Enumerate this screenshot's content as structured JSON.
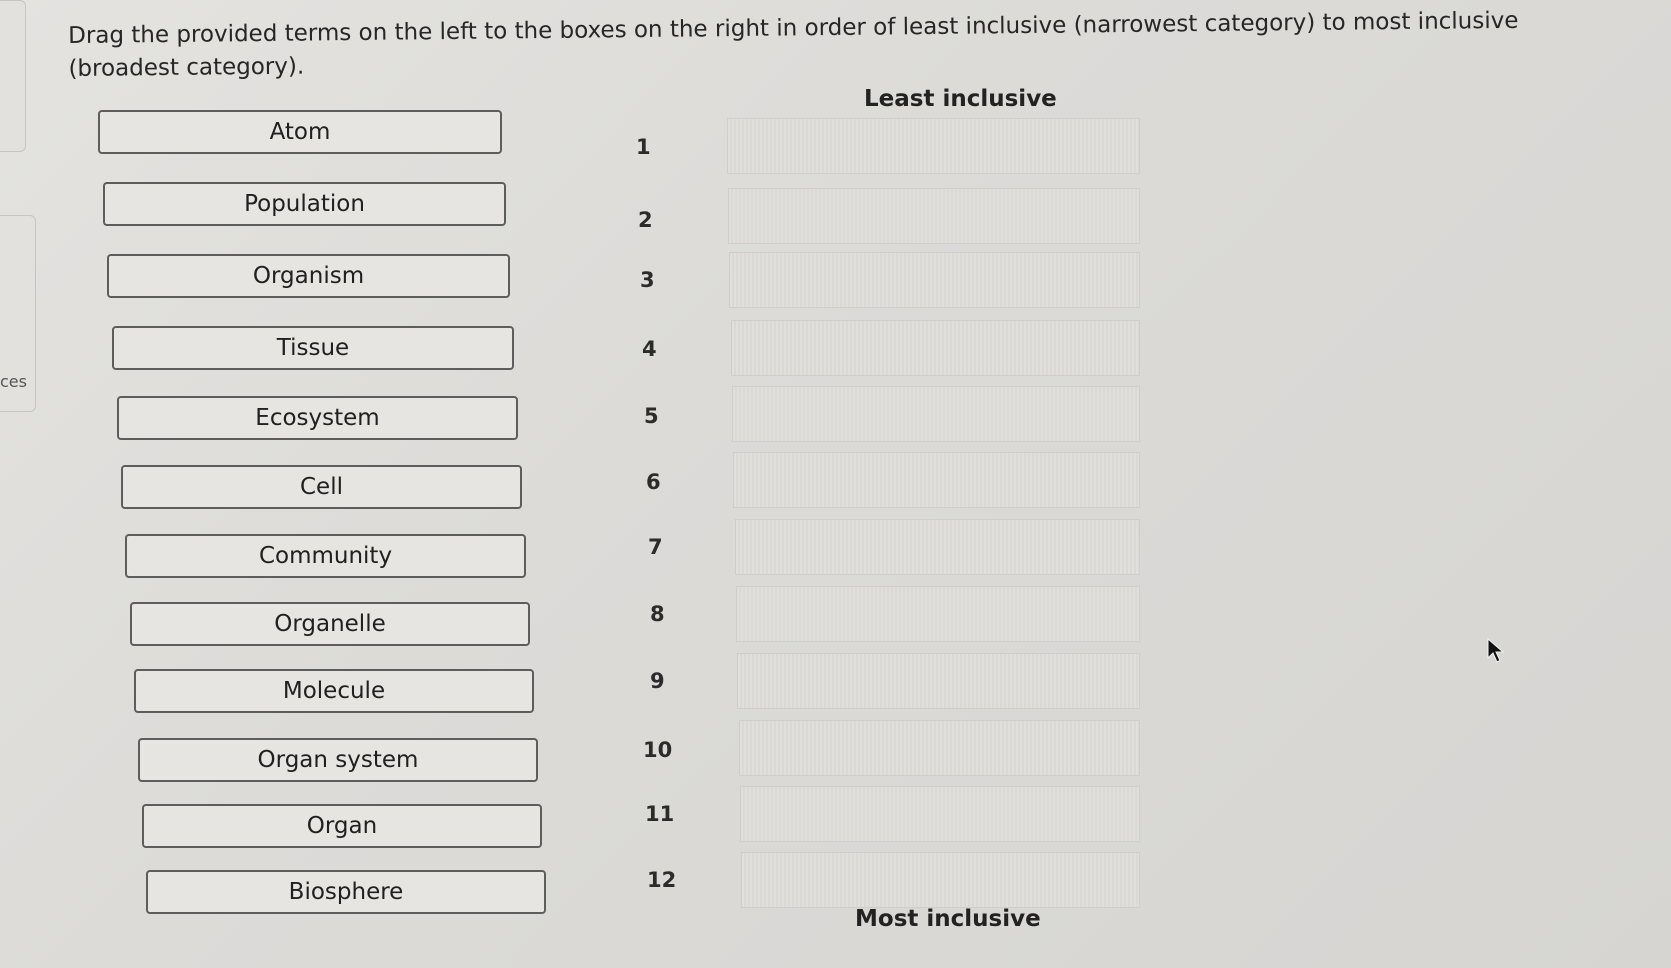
{
  "instructions": "Drag the provided terms on the left to the boxes on the right in order of least inclusive (narrowest category) to most inclusive (broadest category).",
  "side_panel_text": "ces",
  "header_top": "Least inclusive",
  "header_bottom": "Most inclusive",
  "terms": [
    "Atom",
    "Population",
    "Organism",
    "Tissue",
    "Ecosystem",
    "Cell",
    "Community",
    "Organelle",
    "Molecule",
    "Organ system",
    "Organ",
    "Biosphere"
  ],
  "slot_numbers": [
    "1",
    "2",
    "3",
    "4",
    "5",
    "6",
    "7",
    "8",
    "9",
    "10",
    "11",
    "12"
  ],
  "icons": {
    "cursor": "mouse-pointer-icon"
  }
}
